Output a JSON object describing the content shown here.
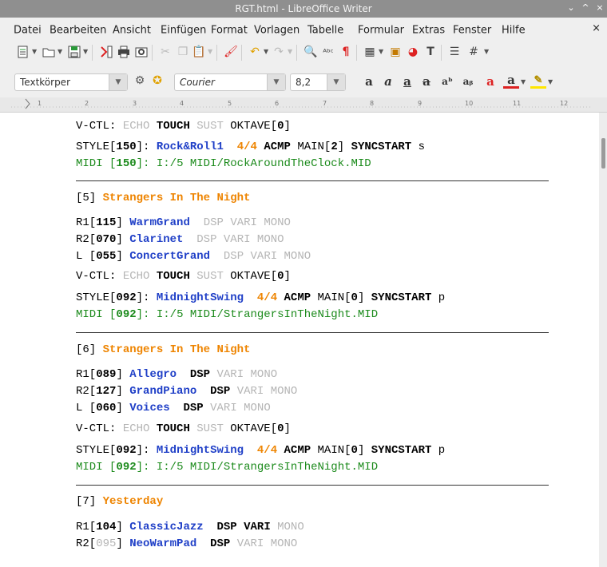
{
  "window": {
    "title": "RGT.html - LibreOffice Writer",
    "min": "⌄",
    "max": "^",
    "close": "×"
  },
  "menu": {
    "items": [
      "Datei",
      "Bearbeiten",
      "Ansicht",
      "Einfügen",
      "Format",
      "Vorlagen",
      "Tabelle",
      "Formular",
      "Extras",
      "Fenster",
      "Hilfe"
    ],
    "close_doc": "×"
  },
  "formatbar": {
    "style": "Textkörper",
    "font": "Courier",
    "size": "8,2"
  },
  "ruler": {
    "numbers": [
      "1",
      "2",
      "3",
      "4",
      "5",
      "6",
      "7",
      "8",
      "9",
      "10",
      "11",
      "12"
    ]
  },
  "document": {
    "lines": [
      {
        "type": "vctl",
        "label": "V-CTL:",
        "echo": "ECHO",
        "touch": "TOUCH",
        "sust": "SUST",
        "oktave": "OKTAVE[",
        "oktave_val": "0",
        "oktave_end": "]"
      },
      {
        "type": "style",
        "pre": "STYLE[",
        "num": "150",
        "mid": "]: ",
        "name": "Rock&Roll1",
        "time": "4/4",
        "acmp": "ACMP",
        "main": "MAIN[",
        "main_val": "2",
        "main_end": "]",
        "sync": "SYNCSTART",
        "tail": "s"
      },
      {
        "type": "midi",
        "pre": "MIDI [",
        "num": "150",
        "mid": "]: ",
        "path": "I:/5 MIDI/RockAroundTheClock.MID"
      },
      {
        "type": "hr"
      },
      {
        "type": "title",
        "index": "[5]",
        "name": "Strangers In The Night"
      },
      {
        "type": "voice",
        "pre": "R1[",
        "num": "115",
        "end": "] ",
        "name": "WarmGrand",
        "dsp": "DSP",
        "vari": "VARI",
        "mono": "MONO",
        "dsp_on": false,
        "vari_on": false
      },
      {
        "type": "voice",
        "pre": "R2[",
        "num": "070",
        "end": "] ",
        "name": "Clarinet",
        "dsp": "DSP",
        "vari": "VARI",
        "mono": "MONO",
        "dsp_on": false,
        "vari_on": false
      },
      {
        "type": "voice",
        "pre": "L [",
        "num": "055",
        "end": "] ",
        "name": "ConcertGrand",
        "dsp": "DSP",
        "vari": "VARI",
        "mono": "MONO",
        "dsp_on": false,
        "vari_on": false
      },
      {
        "type": "vctl",
        "label": "V-CTL:",
        "echo": "ECHO",
        "touch": "TOUCH",
        "sust": "SUST",
        "oktave": "OKTAVE[",
        "oktave_val": "0",
        "oktave_end": "]"
      },
      {
        "type": "style",
        "pre": "STYLE[",
        "num": "092",
        "mid": "]: ",
        "name": "MidnightSwing",
        "time": "4/4",
        "acmp": "ACMP",
        "main": "MAIN[",
        "main_val": "0",
        "main_end": "]",
        "sync": "SYNCSTART",
        "tail": "p"
      },
      {
        "type": "midi",
        "pre": "MIDI [",
        "num": "092",
        "mid": "]: ",
        "path": "I:/5 MIDI/StrangersInTheNight.MID"
      },
      {
        "type": "hr"
      },
      {
        "type": "title",
        "index": "[6]",
        "name": "Strangers In The Night"
      },
      {
        "type": "voice",
        "pre": "R1[",
        "num": "089",
        "end": "] ",
        "name": "Allegro",
        "dsp": "DSP",
        "vari": "VARI",
        "mono": "MONO",
        "dsp_on": true,
        "vari_on": false
      },
      {
        "type": "voice",
        "pre": "R2[",
        "num": "127",
        "end": "] ",
        "name": "GrandPiano",
        "dsp": "DSP",
        "vari": "VARI",
        "mono": "MONO",
        "dsp_on": true,
        "vari_on": false
      },
      {
        "type": "voice",
        "pre": "L [",
        "num": "060",
        "end": "] ",
        "name": "Voices",
        "dsp": "DSP",
        "vari": "VARI",
        "mono": "MONO",
        "dsp_on": true,
        "vari_on": false
      },
      {
        "type": "vctl",
        "label": "V-CTL:",
        "echo": "ECHO",
        "touch": "TOUCH",
        "sust": "SUST",
        "oktave": "OKTAVE[",
        "oktave_val": "0",
        "oktave_end": "]"
      },
      {
        "type": "style",
        "pre": "STYLE[",
        "num": "092",
        "mid": "]: ",
        "name": "MidnightSwing",
        "time": "4/4",
        "acmp": "ACMP",
        "main": "MAIN[",
        "main_val": "0",
        "main_end": "]",
        "sync": "SYNCSTART",
        "tail": "p"
      },
      {
        "type": "midi",
        "pre": "MIDI [",
        "num": "092",
        "mid": "]: ",
        "path": "I:/5 MIDI/StrangersInTheNight.MID"
      },
      {
        "type": "hr"
      },
      {
        "type": "title",
        "index": "[7]",
        "name": "Yesterday"
      },
      {
        "type": "voice",
        "pre": "R1[",
        "num": "104",
        "end": "] ",
        "name": "ClassicJazz",
        "dsp": "DSP",
        "vari": "VARI",
        "mono": "MONO",
        "dsp_on": true,
        "vari_on": true
      },
      {
        "type": "voice",
        "pre": "R2[",
        "num": "095",
        "end": "] ",
        "name": "NeoWarmPad",
        "dsp": "DSP",
        "vari": "VARI",
        "mono": "MONO",
        "dsp_on": true,
        "vari_on": false,
        "num_grey": true
      }
    ]
  }
}
